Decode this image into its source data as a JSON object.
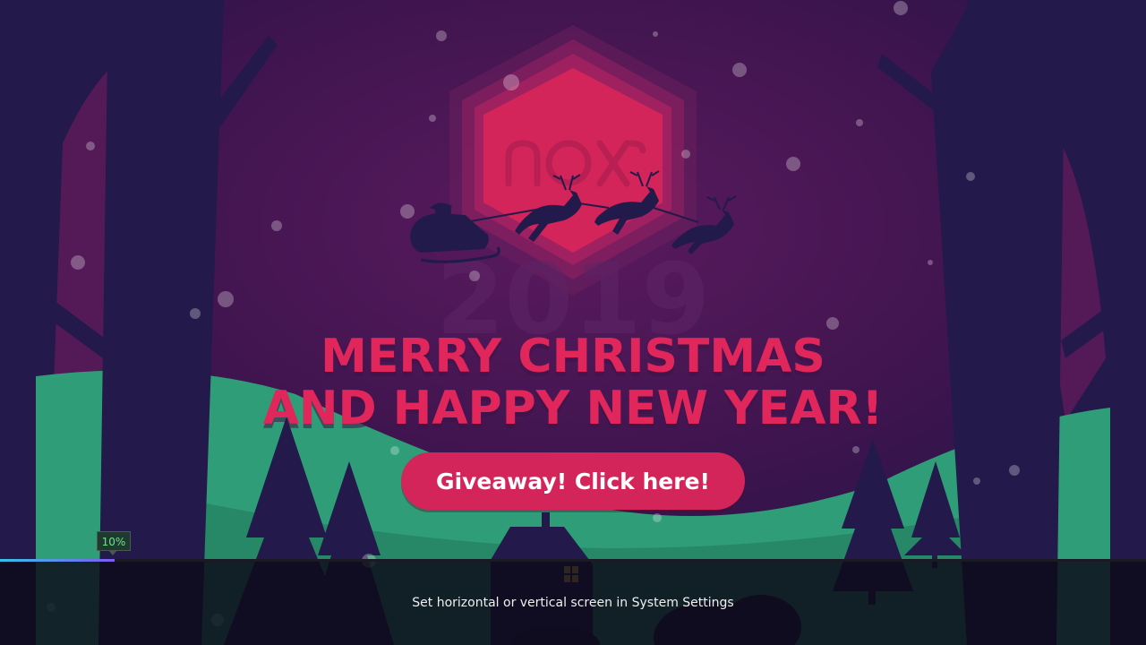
{
  "banner": {
    "brand_logo": "nox-logo",
    "year": "2019",
    "headline_line_1": "MERRY CHRISTMAS",
    "headline_line_2": "AND HAPPY NEW YEAR!",
    "cta_label": "Giveaway! Click here!"
  },
  "loading": {
    "progress_label": "10%",
    "progress_value": 0.1,
    "hint": "Set horizontal or vertical screen in System Settings"
  },
  "colors": {
    "sky": "#3a1350",
    "accent": "#e0265a",
    "hexagon": "#d3255a",
    "hill": "#2f9d78",
    "tree": "#22204f",
    "progress_start": "#35c3e8",
    "progress_end": "#7d5cf0"
  },
  "icons": {
    "sleigh": "santa-sleigh-reindeer-silhouette",
    "house_window": "lit-window-icon"
  }
}
